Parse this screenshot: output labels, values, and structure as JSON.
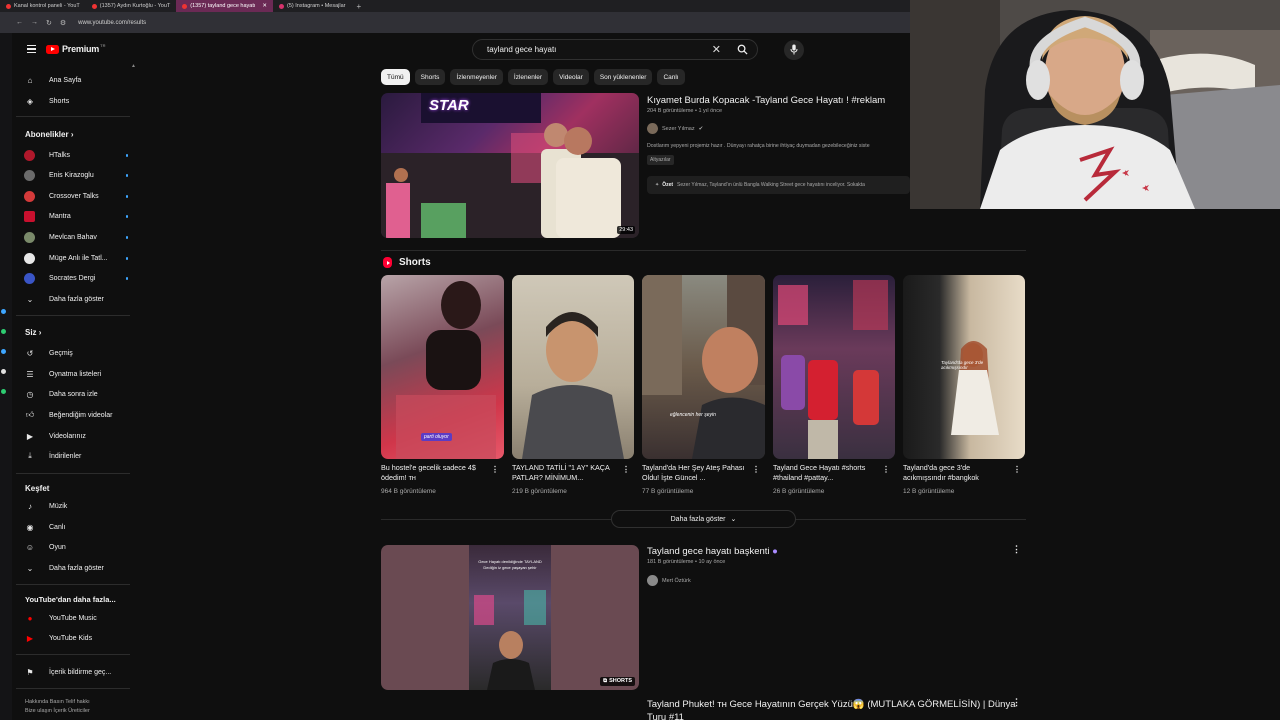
{
  "browser": {
    "tabs": [
      {
        "label": "Kanal kontrol paneli - YouT",
        "active": false
      },
      {
        "label": "(1357) Aydın Kurtoğlu - YouT",
        "active": false
      },
      {
        "label": "(1357) tayland gece hayatı",
        "active": true
      },
      {
        "label": "(5) Instagram • Mesajlar",
        "active": false
      }
    ],
    "url": "www.youtube.com/results"
  },
  "header": {
    "logo_text": "Premium",
    "logo_tm": "TR",
    "search_query": "tayland gece hayatı"
  },
  "sidebar": {
    "main": [
      {
        "label": "Ana Sayfa",
        "icon": "home-icon"
      },
      {
        "label": "Shorts",
        "icon": "shorts-icon"
      }
    ],
    "subscriptions_title": "Abonelikler",
    "subscriptions": [
      {
        "label": "HTalks",
        "color": "#b0182b",
        "live": true
      },
      {
        "label": "Enis Kirazoglu",
        "color": "#6b6b6b",
        "live": true
      },
      {
        "label": "Crossover Talks",
        "color": "#d43a3a",
        "live": true
      },
      {
        "label": "Mantra",
        "color": "#c8102e",
        "live": true
      },
      {
        "label": "Mevlcan Bahav",
        "color": "#7a8a6a",
        "live": true
      },
      {
        "label": "Müge Anlı ile Tatl...",
        "color": "#e8e8e8",
        "live": true
      },
      {
        "label": "Socrates Dergi",
        "color": "#3a55c6",
        "live": true
      }
    ],
    "show_more_1": "Daha fazla göster",
    "you_title": "Siz",
    "you": [
      {
        "label": "Geçmiş",
        "icon": "history-icon"
      },
      {
        "label": "Oynatma listeleri",
        "icon": "playlist-icon"
      },
      {
        "label": "Daha sonra izle",
        "icon": "clock-icon"
      },
      {
        "label": "Beğendiğim videolar",
        "icon": "like-icon"
      },
      {
        "label": "Videolarınız",
        "icon": "your-videos-icon"
      },
      {
        "label": "İndirilenler",
        "icon": "download-icon"
      }
    ],
    "explore_title": "Keşfet",
    "explore": [
      {
        "label": "Müzik",
        "icon": "music-icon"
      },
      {
        "label": "Canlı",
        "icon": "live-icon"
      },
      {
        "label": "Oyun",
        "icon": "gaming-icon"
      }
    ],
    "show_more_2": "Daha fazla göster",
    "more_title": "YouTube'dan daha fazla...",
    "more": [
      {
        "label": "YouTube Music"
      },
      {
        "label": "YouTube Kids"
      }
    ],
    "report": "İçerik bildirme geç...",
    "footer_line1": "Hakkında   Basın   Telif hakkı",
    "footer_line2": "Bize ulaşın   İçerik Üreticiler"
  },
  "chips": [
    "Tümü",
    "Shorts",
    "İzlenmeyenler",
    "İzlenenler",
    "Videolar",
    "Son yüklenenler",
    "Canlı"
  ],
  "results": {
    "first": {
      "title": "Kıyamet Burda Kopacak -Tayland Gece Hayatı ! #reklam",
      "meta": "204 B görüntüleme • 1 yıl önce",
      "channel": "Sezer Yılmaz",
      "desc": "Dostlarım yepyeni projemiz hazır . Dünyayı rahatça birine ihtiyaç duymadan gezebileceğiniz siste",
      "badge": "Altyazılar",
      "summary_label": "Özet",
      "summary_text": "Sezer Yılmaz, Tayland'ın ünlü Bangla Walking Street gece hayatını inceliyor. Sokakta",
      "duration": "29:43",
      "thumb_text": "STAR"
    },
    "shorts_title": "Shorts",
    "shorts": [
      {
        "title": "Bu hostel'e gecelik sadece 4$ ödedim! ᴛʜ",
        "views": "964 B görüntüleme",
        "overlay": "parti oluyor"
      },
      {
        "title": "TAYLAND TATİLİ \"1 AY\" KAÇA PATLAR? MİNİMUM...",
        "views": "219 B görüntüleme",
        "overlay": ""
      },
      {
        "title": "Tayland'da Her Şey Ateş Pahası Oldu! İşte Güncel ...",
        "views": "77 B görüntüleme",
        "overlay": "eğlencenin her şeyin"
      },
      {
        "title": "Tayland Gece Hayatı #shorts  #thailand #pattay...",
        "views": "26 B görüntüleme",
        "overlay": ""
      },
      {
        "title": "Tayland'da gece 3'de acıkmışsındır #bangkok",
        "views": "12 B görüntüleme",
        "overlay": "Tayland'da gece 3'de acıkmışsındır"
      }
    ],
    "show_more": "Daha fazla göster",
    "second": {
      "title": "Tayland gece hayatı başkenti",
      "meta": "181 B görüntüleme • 10 ay önce",
      "channel": "Mert Öztürk",
      "badge": "SHORTS",
      "overlay": "Gece Hayatı denildiğinde TAYLAND Dediğin iz gece yaşayan şehir"
    },
    "third": {
      "title": "Tayland Phuket! ᴛʜ Gece Hayatının Gerçek Yüzü😱 (MUTLAKA GÖRMELİSİN) | Dünya",
      "title2": "Turu #11"
    }
  },
  "colors": {
    "background": "#0f0f0f",
    "accent_red": "#ff0000",
    "live_dot": "#3ea6ff",
    "chip_active": "#f1f1f1"
  }
}
